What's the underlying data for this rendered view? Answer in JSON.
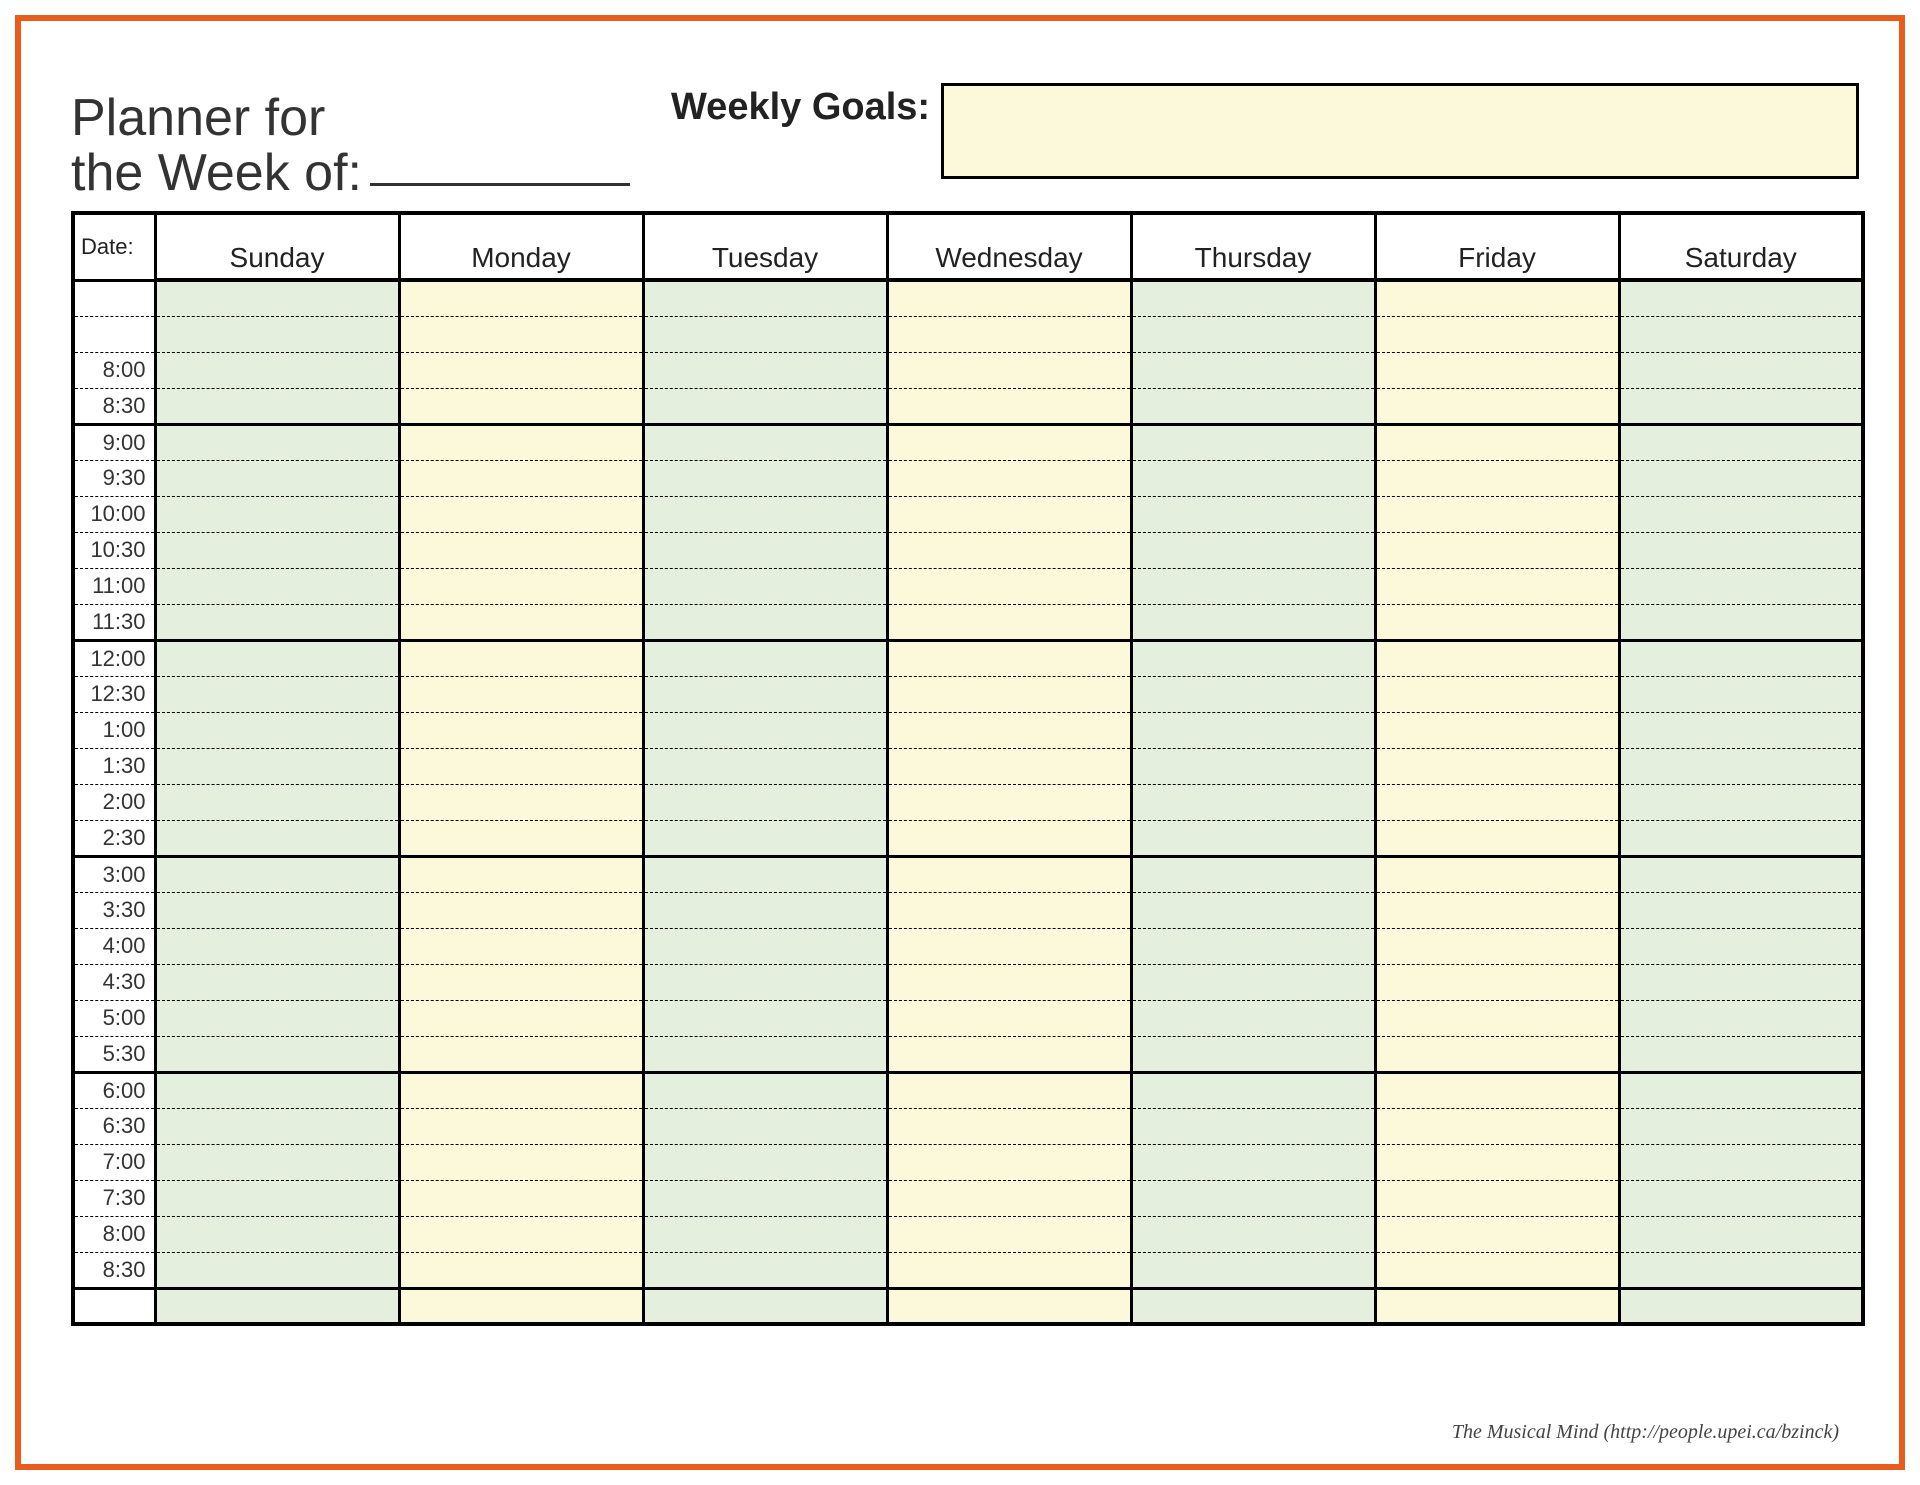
{
  "header": {
    "title_line1": "Planner for",
    "title_line2": "the Week of:",
    "goals_label": "Weekly Goals:",
    "goals_value": ""
  },
  "columns": {
    "date_label": "Date:",
    "days": [
      "Sunday",
      "Monday",
      "Tuesday",
      "Wednesday",
      "Thursday",
      "Friday",
      "Saturday"
    ]
  },
  "day_colors": [
    "green",
    "yellow",
    "green",
    "yellow",
    "green",
    "yellow",
    "green"
  ],
  "rows": [
    {
      "time": "",
      "block_start": true,
      "block_end": false
    },
    {
      "time": "",
      "block_start": false,
      "block_end": false
    },
    {
      "time": "8:00",
      "block_start": false,
      "block_end": false
    },
    {
      "time": "8:30",
      "block_start": false,
      "block_end": true
    },
    {
      "time": "9:00",
      "block_start": true,
      "block_end": false
    },
    {
      "time": "9:30",
      "block_start": false,
      "block_end": false
    },
    {
      "time": "10:00",
      "block_start": false,
      "block_end": false
    },
    {
      "time": "10:30",
      "block_start": false,
      "block_end": false
    },
    {
      "time": "11:00",
      "block_start": false,
      "block_end": false
    },
    {
      "time": "11:30",
      "block_start": false,
      "block_end": true
    },
    {
      "time": "12:00",
      "block_start": true,
      "block_end": false
    },
    {
      "time": "12:30",
      "block_start": false,
      "block_end": false
    },
    {
      "time": "1:00",
      "block_start": false,
      "block_end": false
    },
    {
      "time": "1:30",
      "block_start": false,
      "block_end": false
    },
    {
      "time": "2:00",
      "block_start": false,
      "block_end": false
    },
    {
      "time": "2:30",
      "block_start": false,
      "block_end": true
    },
    {
      "time": "3:00",
      "block_start": true,
      "block_end": false
    },
    {
      "time": "3:30",
      "block_start": false,
      "block_end": false
    },
    {
      "time": "4:00",
      "block_start": false,
      "block_end": false
    },
    {
      "time": "4:30",
      "block_start": false,
      "block_end": false
    },
    {
      "time": "5:00",
      "block_start": false,
      "block_end": false
    },
    {
      "time": "5:30",
      "block_start": false,
      "block_end": true
    },
    {
      "time": "6:00",
      "block_start": true,
      "block_end": false
    },
    {
      "time": "6:30",
      "block_start": false,
      "block_end": false
    },
    {
      "time": "7:00",
      "block_start": false,
      "block_end": false
    },
    {
      "time": "7:30",
      "block_start": false,
      "block_end": false
    },
    {
      "time": "8:00",
      "block_start": false,
      "block_end": false
    },
    {
      "time": "8:30",
      "block_start": false,
      "block_end": true
    },
    {
      "time": "",
      "block_start": true,
      "block_end": true
    }
  ],
  "footer": {
    "credit": "The Musical Mind   (http://people.upei.ca/bzinck)"
  }
}
